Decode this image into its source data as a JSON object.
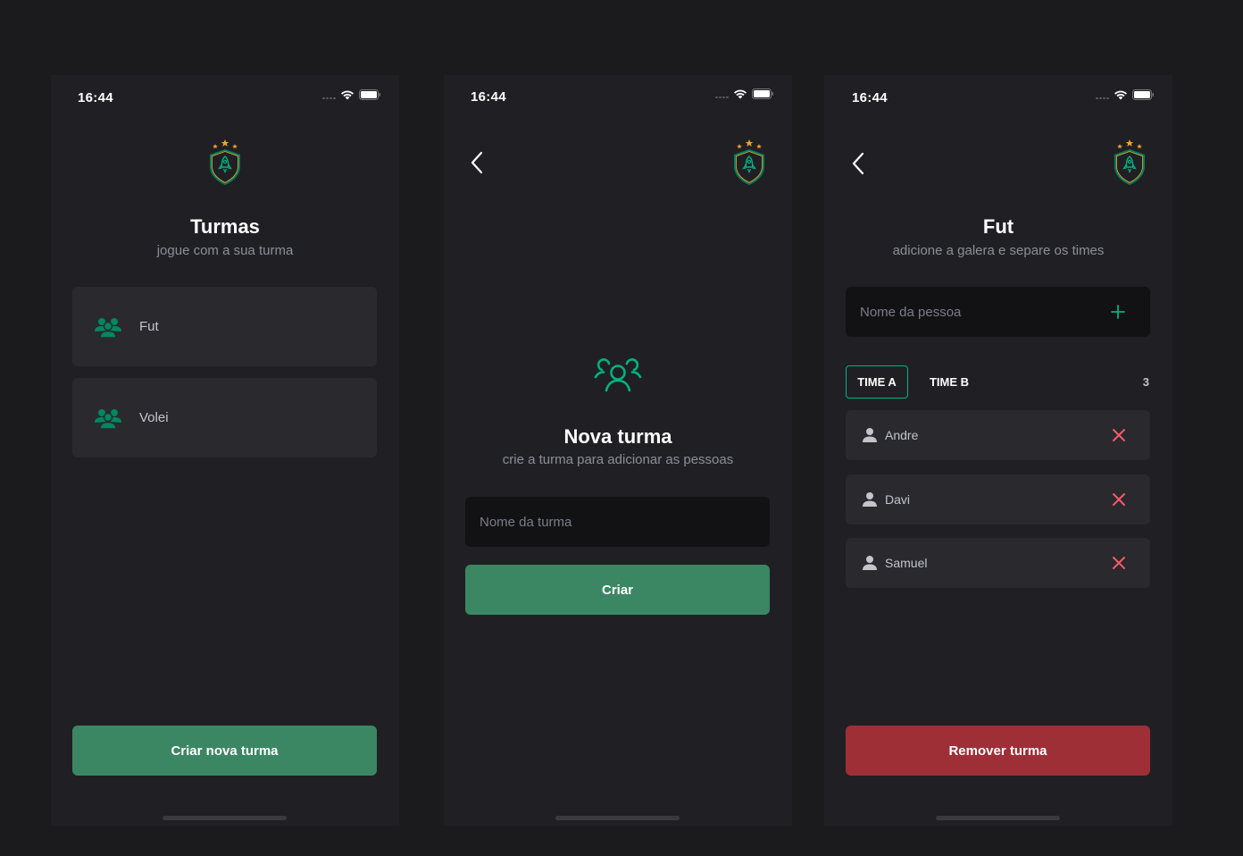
{
  "screens": [
    {
      "status_time": "16:44",
      "title": "Turmas",
      "subtitle": "jogue com a sua turma",
      "groups": [
        {
          "label": "Fut"
        },
        {
          "label": "Volei"
        }
      ],
      "create_button": "Criar nova turma",
      "icons": [
        "wifi-icon",
        "battery-icon",
        "logo-icon",
        "group-icon"
      ]
    },
    {
      "status_time": "16:44",
      "title": "Nova turma",
      "subtitle": "crie a turma para adicionar as pessoas",
      "input_placeholder": "Nome da turma",
      "create_button": "Criar",
      "icons": [
        "back-arrow-icon",
        "logo-icon",
        "users-icon"
      ]
    },
    {
      "status_time": "16:44",
      "title": "Fut",
      "subtitle": "adicione a galera e separe os times",
      "input_placeholder": "Nome da pessoa",
      "tabs": [
        {
          "label": "TIME A",
          "active": true
        },
        {
          "label": "TIME B",
          "active": false
        }
      ],
      "player_count": "3",
      "players": [
        {
          "name": "Andre"
        },
        {
          "name": "Davi"
        },
        {
          "name": "Samuel"
        }
      ],
      "remove_button": "Remover turma",
      "icons": [
        "back-arrow-icon",
        "logo-icon",
        "plus-icon",
        "person-icon",
        "close-icon"
      ]
    }
  ],
  "colors": {
    "background": "#202024",
    "card": "#29292e",
    "input": "#121214",
    "green": "#3b8763",
    "green_accent": "#00b37e",
    "red": "#9e2f36",
    "red_icon": "#f75a68",
    "text_primary": "#ffffff",
    "text_secondary": "#8d8d99"
  }
}
